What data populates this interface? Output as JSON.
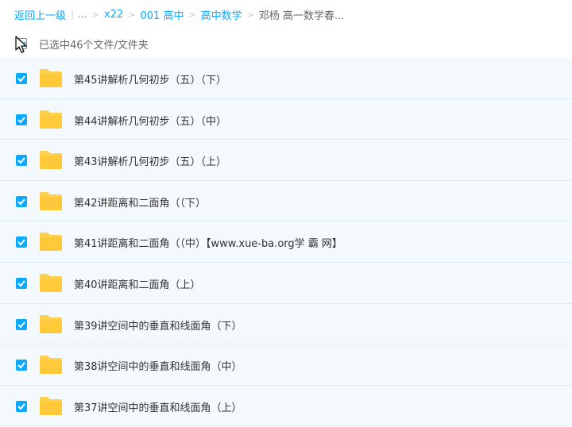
{
  "breadcrumb": {
    "back": "返回上一级",
    "ellipsis": "...",
    "items": [
      "x22",
      "001 高中",
      "高中数学"
    ],
    "current": "邓杨 高一数学春..."
  },
  "selection": {
    "text": "已选中46个文件/文件夹"
  },
  "files": [
    {
      "name": "第45讲解析几何初步（五）（下）"
    },
    {
      "name": "第44讲解析几何初步（五）（中）"
    },
    {
      "name": "第43讲解析几何初步（五）（上）"
    },
    {
      "name": "第42讲距离和二面角（（下）"
    },
    {
      "name": "第41讲距离和二面角（（中）【www.xue-ba.org学 霸 网】"
    },
    {
      "name": "第40讲距离和二面角（上）"
    },
    {
      "name": "第39讲空间中的垂直和线面角（下）"
    },
    {
      "name": "第38讲空间中的垂直和线面角（中）"
    },
    {
      "name": "第37讲空间中的垂直和线面角（上）"
    }
  ],
  "colors": {
    "accent": "#09aaff",
    "folder": "#ffd04e",
    "row_bg": "#f4f9fd"
  },
  "icons": {
    "folder": "folder-icon",
    "checkbox": "checkbox-checked-icon",
    "cursor": "mouse-cursor-icon"
  }
}
